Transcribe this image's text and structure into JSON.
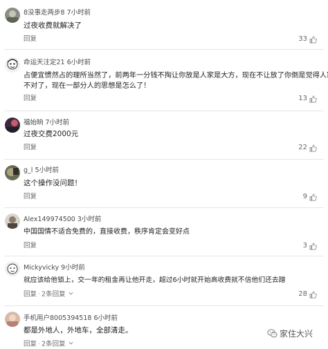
{
  "comments": [
    {
      "user": "8没事走两步8",
      "time": "7小时前",
      "text_lines": [
        "过夜收费就解决了"
      ],
      "reply": "回复",
      "replies": "",
      "likes": "33"
    },
    {
      "user": "命运天注定21",
      "time": "6小时前",
      "text_lines": [
        "占便宜惯然占的理所当然了，前两年一分钱不掏让你放是人家是大方，现在不让放了你倒是觉得人家",
        "不对了，现在一部分人的思想是怎么了！"
      ],
      "reply": "回复",
      "replies": "",
      "likes": "13"
    },
    {
      "user": "福始晌",
      "time": "7小时前",
      "text_lines": [
        "过夜交费2000元"
      ],
      "reply": "回复",
      "replies": "",
      "likes": "22"
    },
    {
      "user": "g_l",
      "time": "5小时前",
      "text_lines": [
        "这个操作没问题！"
      ],
      "reply": "回复",
      "replies": "",
      "likes": "9"
    },
    {
      "user": "Alex149974500",
      "time": "3小时前",
      "text_lines": [
        "中国国情不适合免费的，直接收费，秩序肯定会变好点"
      ],
      "reply": "回复",
      "replies": "",
      "likes": "3"
    },
    {
      "user": "Mickyvicky",
      "time": "9小时前",
      "text_lines": [
        "就应该给他锁上，交一年的租金再让他开走，超过6小时就开始高收费就不信他们还去蹭"
      ],
      "reply": "回复",
      "replies": "2条回复",
      "likes": "28"
    },
    {
      "user": "手机用户8005394518",
      "time": "6小时前",
      "text_lines": [
        "都是外地人，外地车，全部清走。"
      ],
      "reply": "回复",
      "replies": "2条回复",
      "likes": ""
    }
  ],
  "watermark": {
    "text": "家住大兴",
    "icon": "wechat-icon"
  },
  "icons": {
    "like": "thumbs-up-icon",
    "expand": "chevron-down-icon"
  }
}
